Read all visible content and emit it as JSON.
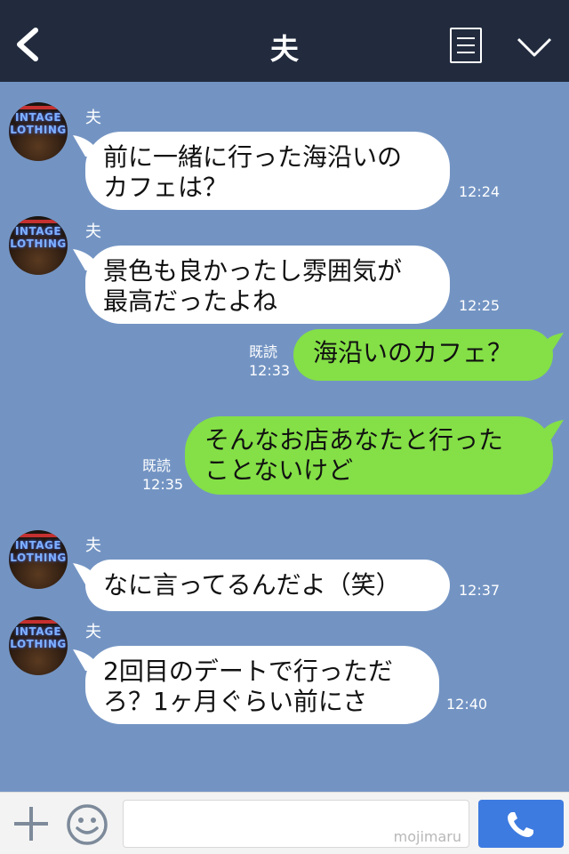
{
  "header": {
    "title": "夫"
  },
  "messages": [
    {
      "sender": "夫",
      "lines": [
        "前に一緒に行った海沿いの",
        "カフェは？"
      ],
      "time": "12:24"
    },
    {
      "sender": "夫",
      "lines": [
        "景色も良かったし雰囲気が",
        "最高だったよね"
      ],
      "time": "12:25"
    },
    {
      "sender": "me",
      "lines": [
        "海沿いのカフェ？"
      ],
      "read": "既読",
      "time": "12:33"
    },
    {
      "sender": "me",
      "lines": [
        "そんなお店あなたと行った",
        "ことないけど"
      ],
      "read": "既読",
      "time": "12:35"
    },
    {
      "sender": "夫",
      "lines": [
        "なに言ってるんだよ（笑）"
      ],
      "time": "12:37"
    },
    {
      "sender": "夫",
      "lines": [
        "2回目のデートで行っただ",
        "ろ？1ヶ月ぐらい前にさ"
      ],
      "time": "12:40"
    }
  ],
  "avatar": {
    "sign_line1": "INTAGE",
    "sign_line2": "LOTHING"
  },
  "composer": {
    "watermark": "mojimaru"
  },
  "colors": {
    "header": "#222b3e",
    "chat_bg": "#7394c3",
    "outgoing": "#84e046",
    "incoming": "#ffffff",
    "call_button": "#3e7be0"
  },
  "icons": [
    "back-chevron-icon",
    "menu-list-icon",
    "chevron-down-icon",
    "plus-icon",
    "smiley-icon",
    "phone-icon"
  ]
}
